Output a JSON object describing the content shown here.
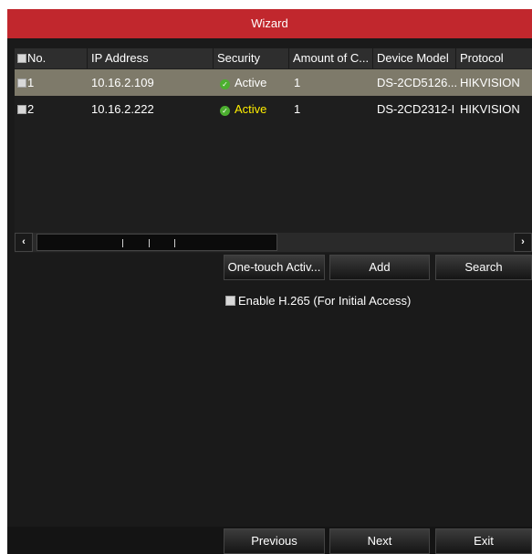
{
  "title": "Wizard",
  "table": {
    "headers": [
      "No.",
      "IP Address",
      "Security",
      "Amount of C...",
      "Device Model",
      "Protocol"
    ],
    "rows": [
      {
        "no": "1",
        "ip": "10.16.2.109",
        "security": "Active",
        "amount": "1",
        "model": "DS-2CD5126...",
        "protocol": "HIKVISION",
        "selected": true
      },
      {
        "no": "2",
        "ip": "10.16.2.222",
        "security": "Active",
        "amount": "1",
        "model": "DS-2CD2312-I",
        "protocol": "HIKVISION",
        "selected": false
      }
    ]
  },
  "scrollbar": {
    "left_arrow": "‹",
    "right_arrow": "›"
  },
  "actions": {
    "one_touch": "One-touch Activ...",
    "add": "Add",
    "search": "Search"
  },
  "option": {
    "enable_h265": "Enable H.265 (For Initial Access)",
    "checked": false
  },
  "footer": {
    "previous": "Previous",
    "next": "Next",
    "exit": "Exit"
  },
  "colors": {
    "title_bar": "#c1272d",
    "selected_row": "#7e7a6a",
    "active_highlight": "#ffee00",
    "security_icon": "#4caf2f"
  }
}
